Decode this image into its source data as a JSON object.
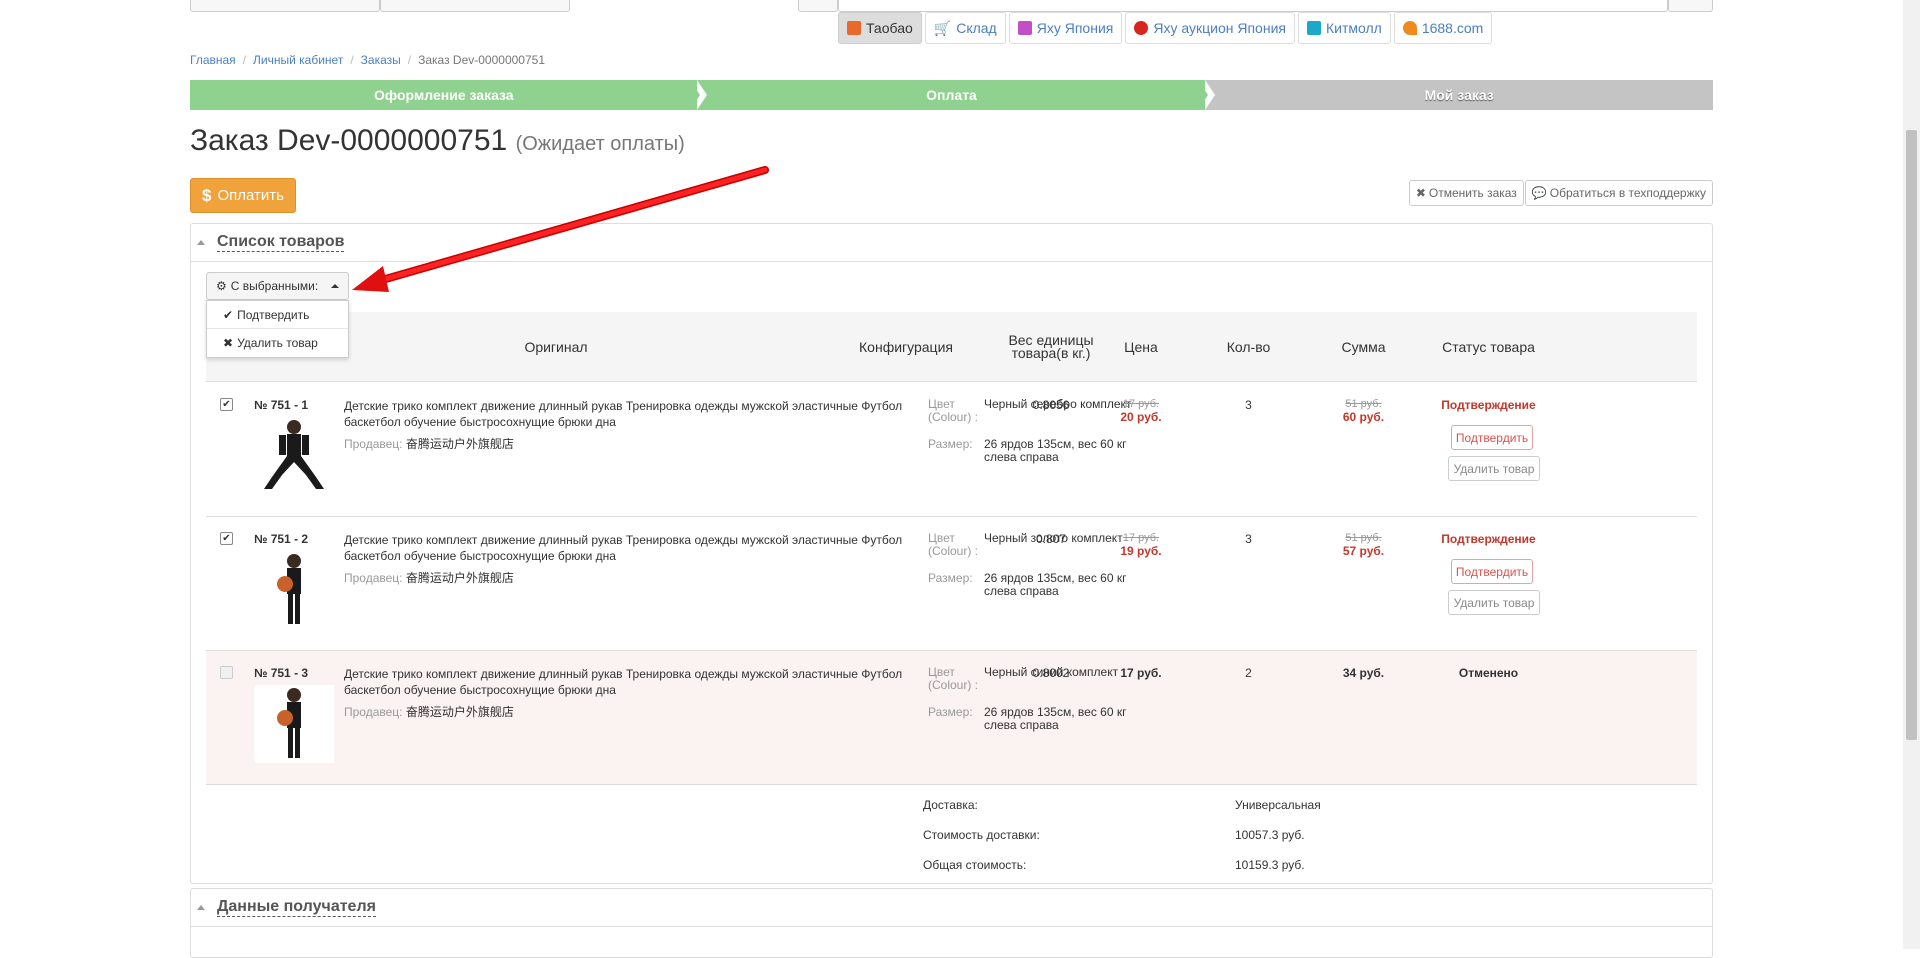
{
  "tabs": [
    {
      "label": "Таобао",
      "color": "#e8692c",
      "active": true
    },
    {
      "label": "Склад",
      "color": "#333333",
      "active": false
    },
    {
      "label": "Яху Япония",
      "color": "#c34fc8",
      "active": false
    },
    {
      "label": "Яху аукцион Япония",
      "color": "#d8261f",
      "active": false
    },
    {
      "label": "Китмолл",
      "color": "#1aa9c8",
      "active": false
    },
    {
      "label": "1688.com",
      "color": "#f08a1c",
      "active": false
    }
  ],
  "breadcrumb": [
    "Главная",
    "Личный кабинет",
    "Заказы",
    "Заказ Dev-0000000751"
  ],
  "steps": [
    "Оформление заказа",
    "Оплата",
    "Мой заказ"
  ],
  "order": {
    "title": "Заказ Dev-0000000751",
    "status": "(Ожидает оплаты)"
  },
  "pay_label": "Оплатить",
  "pay_symbol": "$",
  "cancel_order_label": "Отменить заказ",
  "support_label": "Обратиться в техподдержку",
  "goods_panel_title": "Список товаров",
  "with_selected_label": "С выбранными:",
  "dropdown": {
    "confirm": "Подтвердить",
    "delete": "Удалить товар"
  },
  "columns": {
    "original": "Оригинал",
    "config": "Конфигурация",
    "weight": "Вес единицы товара(в кг.)",
    "price": "Цена",
    "qty": "Кол-во",
    "sum": "Сумма",
    "status": "Статус товара"
  },
  "labels": {
    "seller": "Продавец:",
    "color": "Цвет (Colour) :",
    "size": "Размер:",
    "confirm_btn": "Подтвердить",
    "delete_btn": "Удалить товар"
  },
  "items": [
    {
      "num": "№ 751 - 1",
      "checked": true,
      "title": "Детские трико комплект движение длинный рукав Тренировка одежды мужской эластичные Футбол баскетбол обучение быстросохнущие брюки дна",
      "seller": "奋腾运动户外旗舰店",
      "color": "Черный серебро комплект",
      "size": "26 ярдов 135см, вес 60 кг слева справа",
      "weight": "0.8056",
      "price_old": "17 руб.",
      "price": "20 руб.",
      "qty": "3",
      "sum_old": "51 руб.",
      "sum": "60 руб.",
      "status": "Подтверждение"
    },
    {
      "num": "№ 751 - 2",
      "checked": true,
      "title": "Детские трико комплект движение длинный рукав Тренировка одежды мужской эластичные Футбол баскетбол обучение быстросохнущие брюки дна",
      "seller": "奋腾运动户外旗舰店",
      "color": "Черный золото комплект",
      "size": "26 ярдов 135см, вес 60 кг слева справа",
      "weight": "0.807",
      "price_old": "17 руб.",
      "price": "19 руб.",
      "qty": "3",
      "sum_old": "51 руб.",
      "sum": "57 руб.",
      "status": "Подтверждение"
    },
    {
      "num": "№ 751 - 3",
      "checked": false,
      "title": "Детские трико комплект движение длинный рукав Тренировка одежды мужской эластичные Футбол баскетбол обучение быстросохнущие брюки дна",
      "seller": "奋腾运动户外旗舰店",
      "color": "Черный синий комплект",
      "size": "26 ярдов 135см, вес 60 кг слева справа",
      "weight": "0.8002",
      "price": "17 руб.",
      "qty": "2",
      "sum": "34 руб.",
      "status": "Отменено"
    }
  ],
  "totals": {
    "delivery_label": "Доставка:",
    "delivery_value": "Универсальная",
    "delivery_cost_label": "Стоимость доставки:",
    "delivery_cost_value": "10057.3 руб.",
    "total_label": "Общая стоимость:",
    "total_value": "10159.3 руб."
  },
  "recipient_panel_title": "Данные получателя",
  "colors": {
    "step_done": "#8fd18f",
    "step_todo": "#c4c4c4",
    "pay": "#f0a23b",
    "accent_red": "#c0392b",
    "link": "#4a7fc1"
  }
}
